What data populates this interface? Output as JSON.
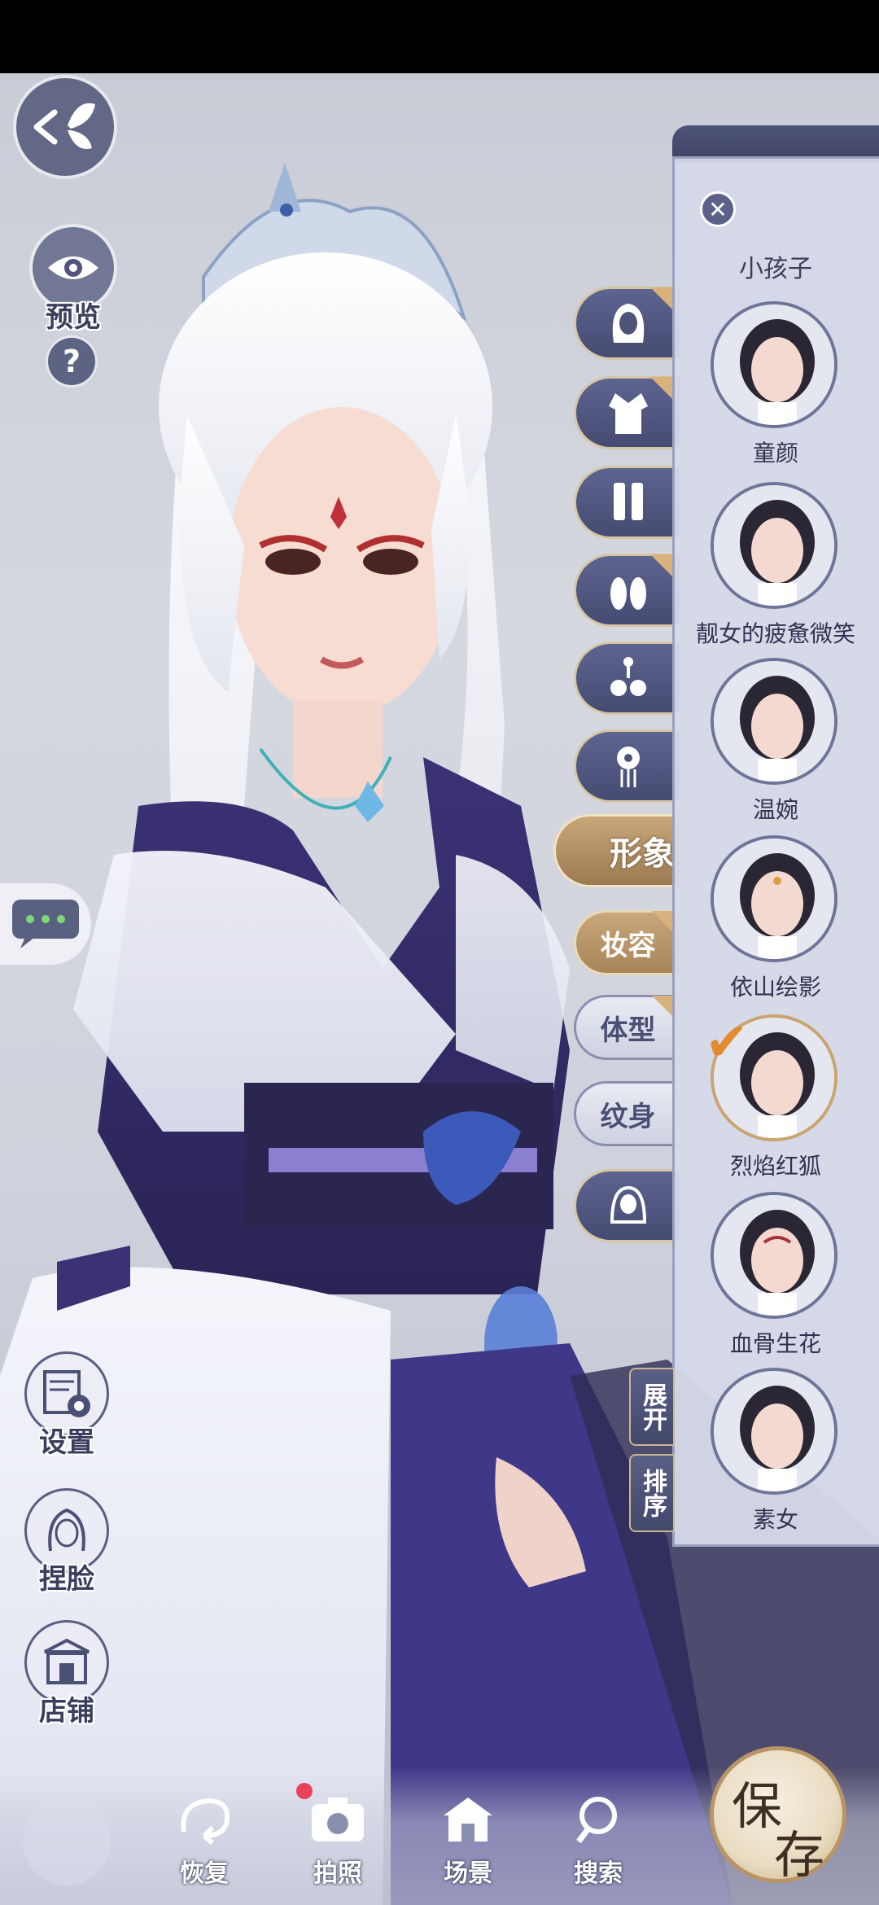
{
  "top_left": {
    "back_icon": "butterfly-back-icon",
    "preview_label": "预览",
    "help_label": "?"
  },
  "chat": {
    "icon": "chat-bubble-icon"
  },
  "left_menu": [
    {
      "label": "设置",
      "icon": "settings-gear-icon"
    },
    {
      "label": "捏脸",
      "icon": "face-sculpt-icon"
    },
    {
      "label": "店铺",
      "icon": "shop-icon"
    }
  ],
  "category_icon_tabs": [
    {
      "icon": "hair-icon"
    },
    {
      "icon": "outfit-icon"
    },
    {
      "icon": "leggings-icon"
    },
    {
      "icon": "shoes-icon"
    },
    {
      "icon": "accessory-icon"
    },
    {
      "icon": "hairpin-icon"
    }
  ],
  "category_text_tabs": {
    "image": "形象",
    "makeup": "妆容",
    "body": "体型",
    "tattoo": "纹身"
  },
  "bottom_cat_icon": "veil-icon",
  "side_tabs": {
    "expand": "展开",
    "sort": "排序"
  },
  "panel": {
    "partial_header": "小孩子",
    "faces": [
      {
        "name": "童颜",
        "selected": false
      },
      {
        "name": "靓女的疲惫微笑",
        "selected": false
      },
      {
        "name": "温婉",
        "selected": false
      },
      {
        "name": "依山绘影",
        "selected": false
      },
      {
        "name": "烈焰红狐",
        "selected": true
      },
      {
        "name": "血骨生花",
        "selected": false
      },
      {
        "name": "素女",
        "selected": false
      }
    ]
  },
  "bottom": {
    "restore": "恢复",
    "photo": "拍照",
    "scene": "场景",
    "search": "搜索",
    "save_chars": [
      "保",
      "存"
    ]
  },
  "colors": {
    "accent_gold": "#c9a77a",
    "tab_navy": "#4e5478",
    "check_orange": "#e38b2f",
    "notification_red": "#e8425a"
  }
}
